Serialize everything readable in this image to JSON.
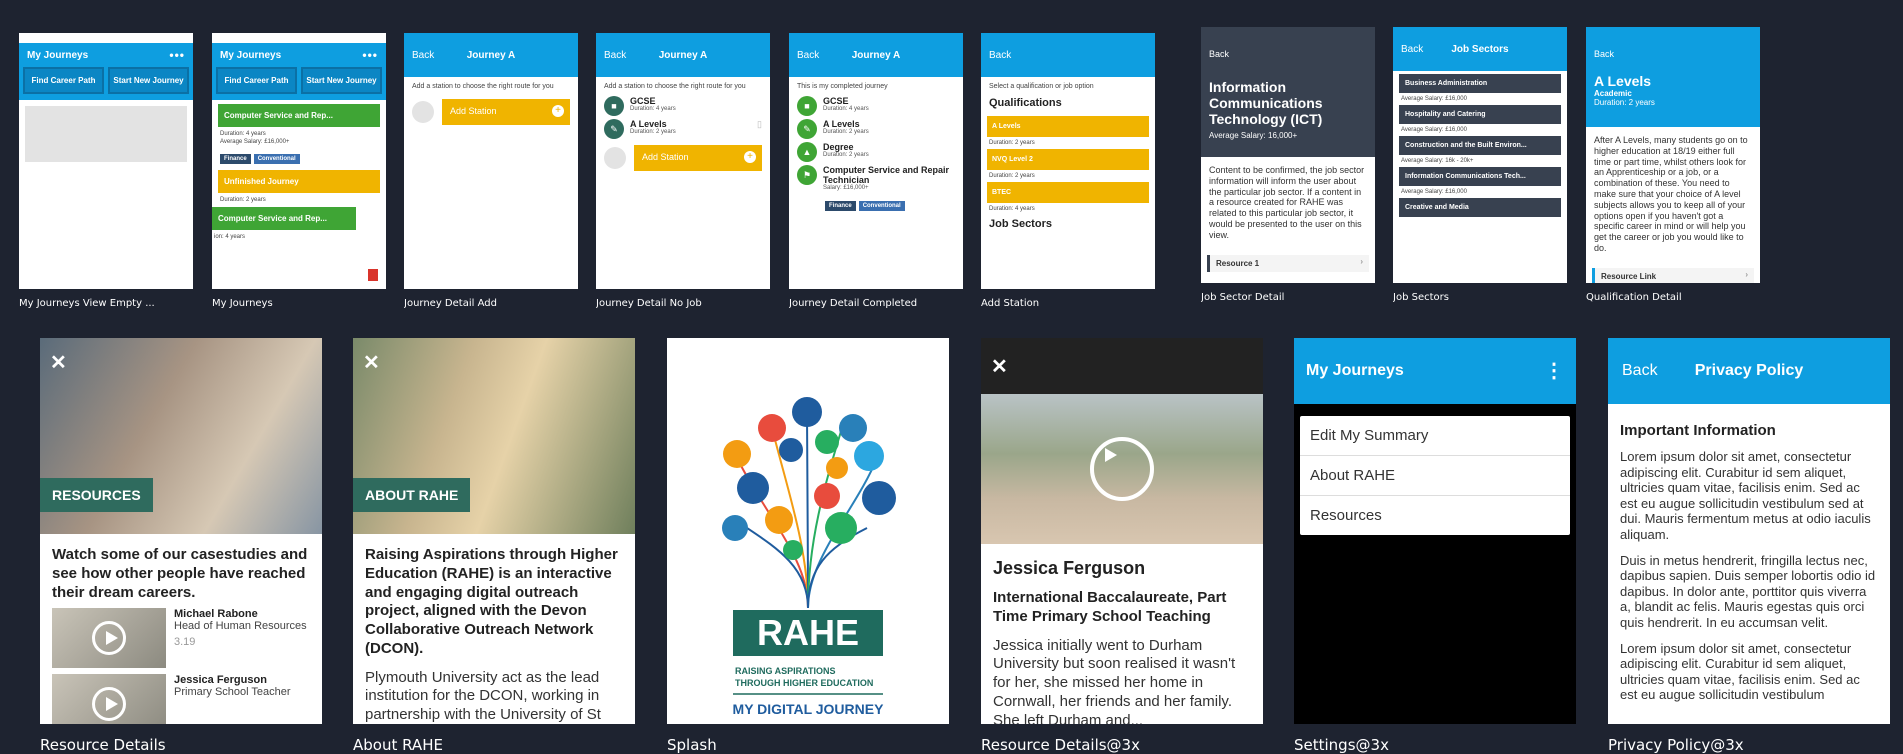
{
  "captions": {
    "c1": "My Journeys View Empty ...",
    "c2": "My Journeys",
    "c3": "Journey Detail Add",
    "c4": "Journey Detail No Job",
    "c5": "Journey Detail Completed",
    "c6": "Add Station",
    "c7": "Job Sector Detail",
    "c8": "Job Sectors",
    "c9": "Qualification Detail",
    "c10": "Resource Details",
    "c11": "About RAHE",
    "c12": "Splash",
    "c13": "Resource Details@3x",
    "c14": "Settings@3x",
    "c15": "Privacy Policy@3x"
  },
  "common": {
    "my_journeys": "My Journeys",
    "more": "•••",
    "back": "Back",
    "journey_a": "Journey A",
    "find_career_path": "Find Career Path",
    "start_new_journey": "Start New Journey",
    "add_station": "Add Station",
    "add_station_hint": "Add a station to choose the right route for you"
  },
  "my_journeys": {
    "card1_title": "Computer Service and Rep...",
    "card1_duration": "Duration: 4 years",
    "card1_salary": "Average Salary: £16,000+",
    "tag_finance": "Finance",
    "tag_conventional": "Conventional",
    "card2_title": "Unfinished Journey",
    "card2_duration": "Duration: 2 years",
    "card3_title": "Computer Service and Rep...",
    "card3_duration": "ion: 4 years"
  },
  "no_job": {
    "s1": "GCSE",
    "s1d": "Duration: 4 years",
    "s2": "A Levels",
    "s2d": "Duration: 2 years"
  },
  "completed": {
    "intro": "This is my completed journey",
    "s1": "GCSE",
    "s1d": "Duration: 4 years",
    "s2": "A Levels",
    "s2d": "Duration: 2 years",
    "s3": "Degree",
    "s3d": "Duration: 2 years",
    "s4": "Computer Service and Repair Technician",
    "s4d": "Salary: £16,000+",
    "tag1": "Finance",
    "tag2": "Conventional"
  },
  "add_station": {
    "intro": "Select a qualification or job option",
    "heading": "Qualifications",
    "q1": "A Levels",
    "q1d": "Duration: 2 years",
    "q2": "NVQ Level 2",
    "q2d": "Duration: 2 years",
    "q3": "BTEC",
    "q3d": "Duration: 4 years",
    "heading2": "Job Sectors"
  },
  "job_sector_detail": {
    "title": "Information Communications Technology (ICT)",
    "salary": "Average Salary: 16,000+",
    "body": "Content to be confirmed, the job sector information will inform the user about the particular job sector. If a content in a resource created for RAHE was related to this particular job sector, it would be presented to the user on this view.",
    "resource": "Resource 1"
  },
  "job_sectors": {
    "title": "Job Sectors",
    "items": [
      {
        "name": "Business Administration",
        "salary": "Average Salary: £16,000"
      },
      {
        "name": "Hospitality and Catering",
        "salary": "Average Salary: £16,000"
      },
      {
        "name": "Construction and the Built Environ...",
        "salary": "Average Salary: 16k - 20k+"
      },
      {
        "name": "Information Communications Tech...",
        "salary": "Average Salary: £16,000"
      },
      {
        "name": "Creative and Media",
        "salary": ""
      }
    ]
  },
  "qual_detail": {
    "title": "A Levels",
    "type": "Academic",
    "duration": "Duration: 2 years",
    "body": "After A Levels, many students go on to higher education at 18/19 either full time or part time, whilst others look for an Apprenticeship or a job, or a combination of these. You need to make sure that your choice of A level subjects allows you to keep all of your options open if you haven't got a specific career in mind or will help you get the career or job you would like to do.",
    "link": "Resource Link"
  },
  "resources": {
    "banner": "RESOURCES",
    "intro": "Watch some of our casestudies and see how other people have reached their dream careers.",
    "p1_name": "Michael Rabone",
    "p1_role": "Head of Human Resources",
    "p1_time": "3.19",
    "p2_name": "Jessica Ferguson",
    "p2_role": "Primary School Teacher"
  },
  "about": {
    "banner": "ABOUT RAHE",
    "intro": "Raising Aspirations through Higher Education (RAHE) is an interactive and engaging digital outreach project, aligned with the Devon Collaborative Outreach Network (DCON).",
    "body": "Plymouth University act as the lead institution for the DCON, working in partnership with the University of St Mark & St John and the Plymouth..."
  },
  "splash": {
    "logo": "RAHE",
    "tagline1": "RAISING ASPIRATIONS",
    "tagline2": "THROUGH HIGHER EDUCATION",
    "footer": "MY DIGITAL JOURNEY"
  },
  "resource3x": {
    "name": "Jessica Ferguson",
    "subtitle": "International Baccalaureate, Part Time Primary School Teaching",
    "body": "Jessica initially went to Durham University but soon realised it wasn't for her, she missed her home in Cornwall, her friends and her family. She left Durham and..."
  },
  "settings": {
    "title": "My Journeys",
    "items": [
      "Edit My Summary",
      "About RAHE",
      "Resources"
    ]
  },
  "privacy": {
    "back": "Back",
    "title": "Privacy Policy",
    "heading": "Important Information",
    "p1": "Lorem ipsum dolor sit amet, consectetur adipiscing elit. Curabitur id sem aliquet, ultricies quam vitae, facilisis enim. Sed ac est eu augue sollicitudin vestibulum sed at dui. Mauris fermentum metus at odio iaculis aliquam.",
    "p2": "Duis in metus hendrerit, fringilla lectus nec, dapibus sapien. Duis semper lobortis odio id dapibus. In dolor ante, porttitor quis viverra a, blandit ac felis. Mauris egestas quis orci quis hendrerit. In eu accumsan velit.",
    "p3": "Lorem ipsum dolor sit amet, consectetur adipiscing elit. Curabitur id sem aliquet, ultricies quam vitae, facilisis enim. Sed ac est eu augue sollicitudin vestibulum"
  },
  "colors": {
    "primary": "#0e9ee0",
    "green": "#3fa535",
    "yellow": "#f0b400",
    "dark": "#384150",
    "teal": "#2f6b5e"
  }
}
